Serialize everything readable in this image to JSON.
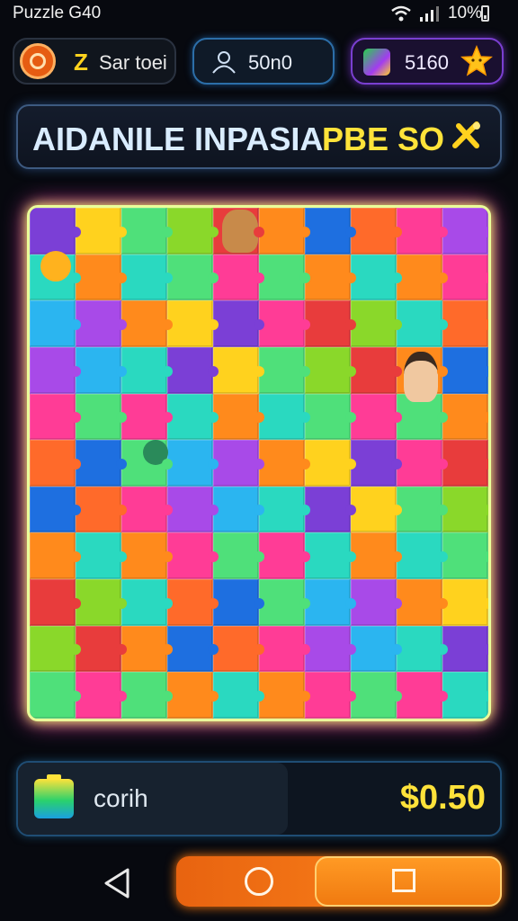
{
  "status_bar": {
    "app_title": "Puzzle G40",
    "battery_text": "10%"
  },
  "top_bar": {
    "player": {
      "z_letter": "Z",
      "name": "Sar toei"
    },
    "players": {
      "value": "50n0"
    },
    "gems": {
      "value": "5160"
    }
  },
  "banner": {
    "title_main": "AIDANILE INPASIA",
    "title_accent": "PBE SO"
  },
  "board": {
    "colors": [
      "#7b3fd6",
      "#ff8a1c",
      "#2bb5f0",
      "#8ad82a",
      "#ff3c96",
      "#ffd21e",
      "#1e6fe0",
      "#2ad9c0",
      "#e83c3c",
      "#a84ae8",
      "#4fe07a",
      "#ff6a2a"
    ]
  },
  "footer": {
    "label": "corih",
    "price": "$0.50"
  },
  "colors": {
    "accent": "#ffe23a",
    "nav": "#ff8a1c",
    "frame_glow": "#f0ff60"
  }
}
